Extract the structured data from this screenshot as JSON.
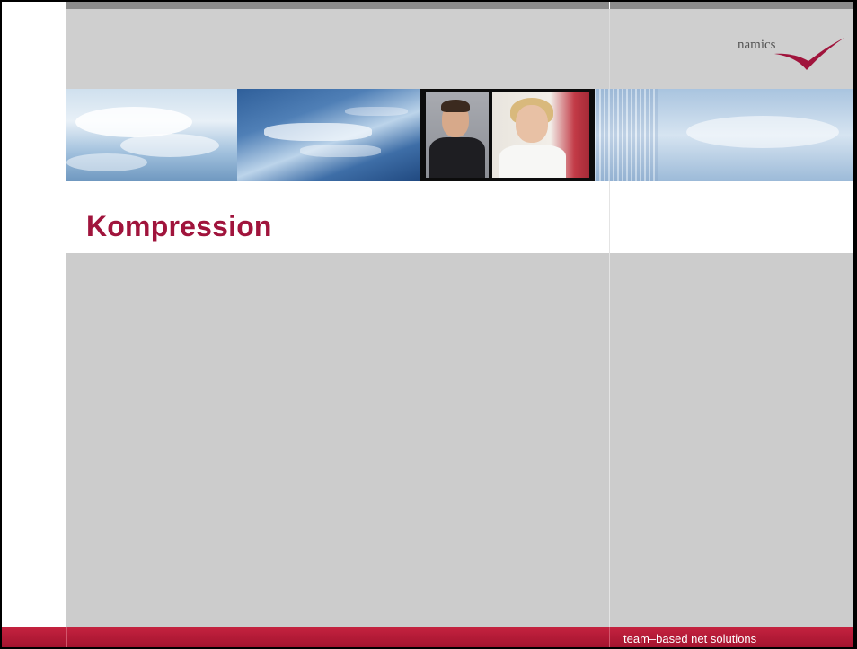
{
  "slide": {
    "title": "Kompression",
    "footer_tagline": "team–based net solutions"
  },
  "brand": {
    "logo_text": "namics",
    "logo_icon": "namics-swoosh-logo",
    "accent_color": "#a0143c",
    "footer_color": "#b81a3a"
  },
  "banner": {
    "image": "ocean-and-people-photo-banner"
  }
}
